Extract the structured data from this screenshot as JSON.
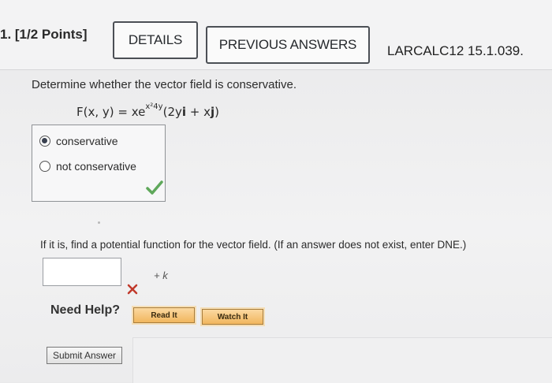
{
  "question": {
    "number": "1. [1/2 Points]",
    "details_label": "DETAILS",
    "previous_answers_label": "PREVIOUS ANSWERS",
    "course_code": "LARCALC12 15.1.039."
  },
  "part1": {
    "prompt": "Determine whether the vector field is conservative.",
    "formula": {
      "lhs": "F(x, y) = xe",
      "exponent": "x²4y",
      "paren_open": "(2y",
      "i": "i",
      "plus": " + x",
      "j": "j",
      "paren_close": ")"
    },
    "choices": [
      {
        "label": "conservative",
        "selected": true
      },
      {
        "label": "not conservative",
        "selected": false
      }
    ],
    "result_icon": "check-icon"
  },
  "part2": {
    "prompt": "If it is, find a potential function for the vector field. (If an answer does not exist, enter DNE.)",
    "answer_value": "",
    "suffix": "+ k",
    "result_icon": "x-icon"
  },
  "help": {
    "label": "Need Help?",
    "read_label": "Read It",
    "watch_label": "Watch It"
  },
  "submit_label": "Submit Answer",
  "colors": {
    "check": "#5fa85b",
    "cross": "#c0392b",
    "help_button": "#f1b65e"
  }
}
